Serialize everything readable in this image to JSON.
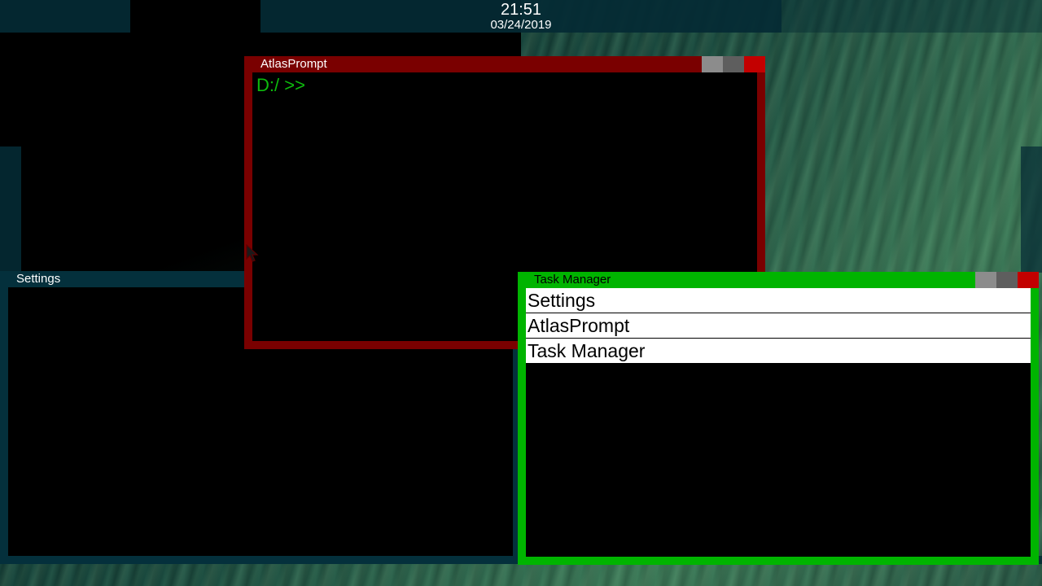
{
  "taskbar": {
    "time": "21:51",
    "date": "03/24/2019"
  },
  "windows": {
    "settings": {
      "title": "Settings"
    },
    "atlas_prompt": {
      "title": "AtlasPrompt",
      "prompt": "D:/ >>"
    },
    "task_manager": {
      "title": "Task Manager",
      "processes": [
        "Settings",
        "AtlasPrompt",
        "Task Manager"
      ]
    }
  },
  "colors": {
    "atlas_frame": "#7a0000",
    "task_manager_frame": "#00b400",
    "prompt_text": "#0dbb0d",
    "close_button": "#c30000",
    "panel_teal": "#04303c"
  }
}
